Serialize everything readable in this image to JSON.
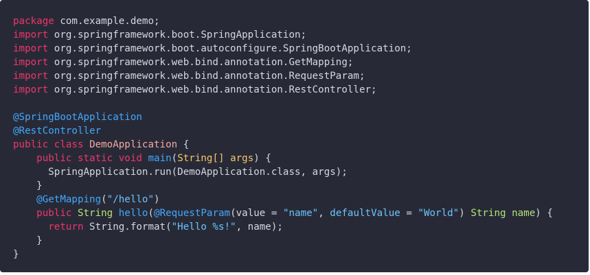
{
  "code_block": {
    "lines": [
      [
        {
          "t": "package",
          "c": "kw"
        },
        {
          "t": " com.example.demo;",
          "c": "plain"
        }
      ],
      [
        {
          "t": "import",
          "c": "kw"
        },
        {
          "t": " org.springframework.boot.SpringApplication;",
          "c": "plain"
        }
      ],
      [
        {
          "t": "import",
          "c": "kw"
        },
        {
          "t": " org.springframework.boot.autoconfigure.SpringBootApplication;",
          "c": "plain"
        }
      ],
      [
        {
          "t": "import",
          "c": "kw"
        },
        {
          "t": " org.springframework.web.bind.annotation.GetMapping;",
          "c": "plain"
        }
      ],
      [
        {
          "t": "import",
          "c": "kw"
        },
        {
          "t": " org.springframework.web.bind.annotation.RequestParam;",
          "c": "plain"
        }
      ],
      [
        {
          "t": "import",
          "c": "kw"
        },
        {
          "t": " org.springframework.web.bind.annotation.RestController;",
          "c": "plain"
        }
      ],
      [],
      [
        {
          "t": "@SpringBootApplication",
          "c": "ann"
        }
      ],
      [
        {
          "t": "@RestController",
          "c": "ann"
        }
      ],
      [
        {
          "t": "public",
          "c": "kw"
        },
        {
          "t": " ",
          "c": "plain"
        },
        {
          "t": "class",
          "c": "kw"
        },
        {
          "t": " ",
          "c": "plain"
        },
        {
          "t": "DemoApplication",
          "c": "cls"
        },
        {
          "t": " {",
          "c": "plain"
        }
      ],
      [
        {
          "t": "    ",
          "c": "plain"
        },
        {
          "t": "public",
          "c": "kw"
        },
        {
          "t": " ",
          "c": "plain"
        },
        {
          "t": "static",
          "c": "kw"
        },
        {
          "t": " ",
          "c": "plain"
        },
        {
          "t": "void",
          "c": "kw"
        },
        {
          "t": " ",
          "c": "plain"
        },
        {
          "t": "main",
          "c": "fn"
        },
        {
          "t": "(",
          "c": "plain"
        },
        {
          "t": "String[] args",
          "c": "param"
        },
        {
          "t": ") {",
          "c": "plain"
        }
      ],
      [
        {
          "t": "      SpringApplication.run(DemoApplication.class, args);",
          "c": "plain"
        }
      ],
      [
        {
          "t": "    }",
          "c": "plain"
        }
      ],
      [
        {
          "t": "    ",
          "c": "plain"
        },
        {
          "t": "@GetMapping",
          "c": "ann"
        },
        {
          "t": "(",
          "c": "plain"
        },
        {
          "t": "\"/hello\"",
          "c": "str"
        },
        {
          "t": ")",
          "c": "plain"
        }
      ],
      [
        {
          "t": "    ",
          "c": "plain"
        },
        {
          "t": "public",
          "c": "kw"
        },
        {
          "t": " ",
          "c": "plain"
        },
        {
          "t": "String",
          "c": "type"
        },
        {
          "t": " ",
          "c": "plain"
        },
        {
          "t": "hello",
          "c": "fn"
        },
        {
          "t": "(",
          "c": "plain"
        },
        {
          "t": "@RequestParam",
          "c": "ann"
        },
        {
          "t": "(value = ",
          "c": "plain"
        },
        {
          "t": "\"name\"",
          "c": "str"
        },
        {
          "t": ", ",
          "c": "plain"
        },
        {
          "t": "defaultValue",
          "c": "lit"
        },
        {
          "t": " = ",
          "c": "plain"
        },
        {
          "t": "\"World\"",
          "c": "str"
        },
        {
          "t": ") ",
          "c": "plain"
        },
        {
          "t": "String name",
          "c": "type"
        },
        {
          "t": ") {",
          "c": "plain"
        }
      ],
      [
        {
          "t": "      ",
          "c": "plain"
        },
        {
          "t": "return",
          "c": "kw"
        },
        {
          "t": " String.format(",
          "c": "plain"
        },
        {
          "t": "\"Hello %s!\"",
          "c": "str"
        },
        {
          "t": ", name);",
          "c": "plain"
        }
      ],
      [
        {
          "t": "    }",
          "c": "plain"
        }
      ],
      [
        {
          "t": "}",
          "c": "plain"
        }
      ]
    ]
  },
  "colors": {
    "background": "#272a36",
    "keyword": "#f0356b",
    "annotation": "#43a7ff",
    "string": "#6cc4ff",
    "type": "#b6e17a",
    "plain": "#d5d8e0"
  }
}
